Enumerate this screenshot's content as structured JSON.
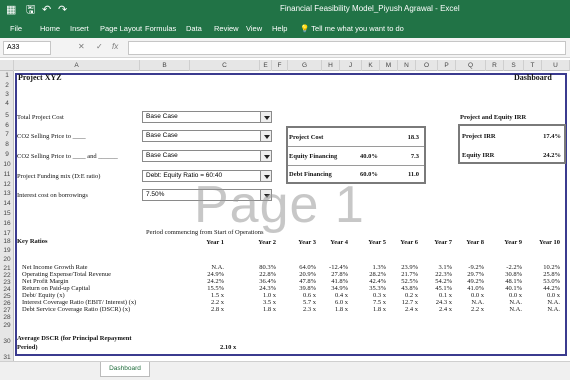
{
  "titlebar": {
    "file_icon": "excel-file-icon",
    "save_glyph": "🖫",
    "undo_glyph": "↶",
    "redo_glyph": "↷",
    "title": "Financial Feasibility Model_Piyush Agrawal  -  Excel"
  },
  "ribbon": {
    "tabs": [
      "File",
      "Home",
      "Insert",
      "Page Layout",
      "Formulas",
      "Data",
      "Review",
      "View",
      "Help"
    ],
    "tell_me": "Tell me what you want to do",
    "bulb_glyph": "💡"
  },
  "formula_bar": {
    "name_box": "A33",
    "cancel_glyph": "✕",
    "enter_glyph": "✓",
    "fx_glyph": "fx",
    "value": ""
  },
  "columns": [
    "A",
    "B",
    "C",
    "E",
    "F",
    "G",
    "H",
    "J",
    "K",
    "M",
    "N",
    "O",
    "P",
    "Q",
    "R",
    "S",
    "T",
    "U"
  ],
  "rows": [
    "1",
    "2",
    "3",
    "4",
    "5",
    "6",
    "7",
    "8",
    "9",
    "10",
    "11",
    "12",
    "13",
    "14",
    "15",
    "16",
    "17",
    "18",
    "19",
    "20",
    "21",
    "22",
    "23",
    "24",
    "25",
    "26",
    "27",
    "28",
    "29",
    "30",
    "31"
  ],
  "sheet": {
    "project_title": "Project XYZ",
    "dashboard_label": "Dashboard",
    "inputs": [
      {
        "label": "Total Project Cost",
        "value": "Base Case"
      },
      {
        "label": "CO2 Selling Price to ____",
        "value": "Base Case"
      },
      {
        "label": "CO2 Selling Price to ____ and ______",
        "value": "Base Case"
      },
      {
        "label": "Project Funding mix (D:E ratio)",
        "value": "Debt: Equity Ratio = 60:40"
      },
      {
        "label": "Interest cost on borrowings",
        "value": "7.50%"
      }
    ],
    "cost_box": {
      "project_cost_label": "Project Cost",
      "project_cost_value": "18.3",
      "equity_label": "Equity Financing",
      "equity_pct": "40.0%",
      "equity_value": "7.3",
      "debt_label": "Debt Financing",
      "debt_pct": "60.0%",
      "debt_value": "11.0"
    },
    "irr_box": {
      "heading": "Project and Equity IRR",
      "project_irr_label": "Project IRR",
      "project_irr_value": "17.4%",
      "equity_irr_label": "Equity IRR",
      "equity_irr_value": "24.2%"
    },
    "period_note": "Period commencing from Start of Operations",
    "key_ratios_label": "Key Ratios",
    "years": [
      "Year 1",
      "Year 2",
      "Year 3",
      "Year 4",
      "Year 5",
      "Year 6",
      "Year 7",
      "Year 8",
      "Year 9",
      "Year 10"
    ],
    "ratios": [
      {
        "label": "Net Income Growth Rate",
        "values": [
          "N.A.",
          "80.3%",
          "64.0%",
          "-12.4%",
          "1.3%",
          "23.9%",
          "3.1%",
          "-9.2%",
          "-2.2%",
          "10.2%"
        ]
      },
      {
        "label": "Operating Expense/Total Revenue",
        "values": [
          "24.9%",
          "22.8%",
          "20.9%",
          "27.8%",
          "28.2%",
          "21.7%",
          "22.3%",
          "29.7%",
          "30.8%",
          "25.8%"
        ]
      },
      {
        "label": "Net Profit Margin",
        "values": [
          "24.2%",
          "36.4%",
          "47.8%",
          "41.8%",
          "42.4%",
          "52.5%",
          "54.2%",
          "49.2%",
          "48.1%",
          "53.0%"
        ]
      },
      {
        "label": "Return on Paid-up Capital",
        "values": [
          "15.5%",
          "24.3%",
          "39.8%",
          "34.9%",
          "35.3%",
          "43.8%",
          "45.1%",
          "41.0%",
          "40.1%",
          "44.2%"
        ]
      },
      {
        "label": "Debt/ Equity (x)",
        "values": [
          "1.5 x",
          "1.0 x",
          "0.6 x",
          "0.4 x",
          "0.3 x",
          "0.2 x",
          "0.1 x",
          "0.0 x",
          "0.0 x",
          "0.0 x"
        ]
      },
      {
        "label": "Interest Coverage Ratio (EBIT/ Interest) (x)",
        "values": [
          "2.2 x",
          "3.5 x",
          "5.7 x",
          "6.0 x",
          "7.5 x",
          "12.7 x",
          "24.3 x",
          "N.A.",
          "N.A.",
          "N.A."
        ]
      },
      {
        "label": "Debt Service Coverage Ratio (DSCR) (x)",
        "values": [
          "2.8 x",
          "1.8 x",
          "2.3 x",
          "1.8 x",
          "1.8 x",
          "2.4 x",
          "2.4 x",
          "2.2 x",
          "N.A.",
          "N.A."
        ]
      }
    ],
    "avg_dscr_label_1": "Average DSCR (for Principal Repayment",
    "avg_dscr_label_2": "Period)",
    "avg_dscr_value": "2.10 x"
  },
  "watermark": "Page 1",
  "active_sheet_tab": "Dashboard"
}
